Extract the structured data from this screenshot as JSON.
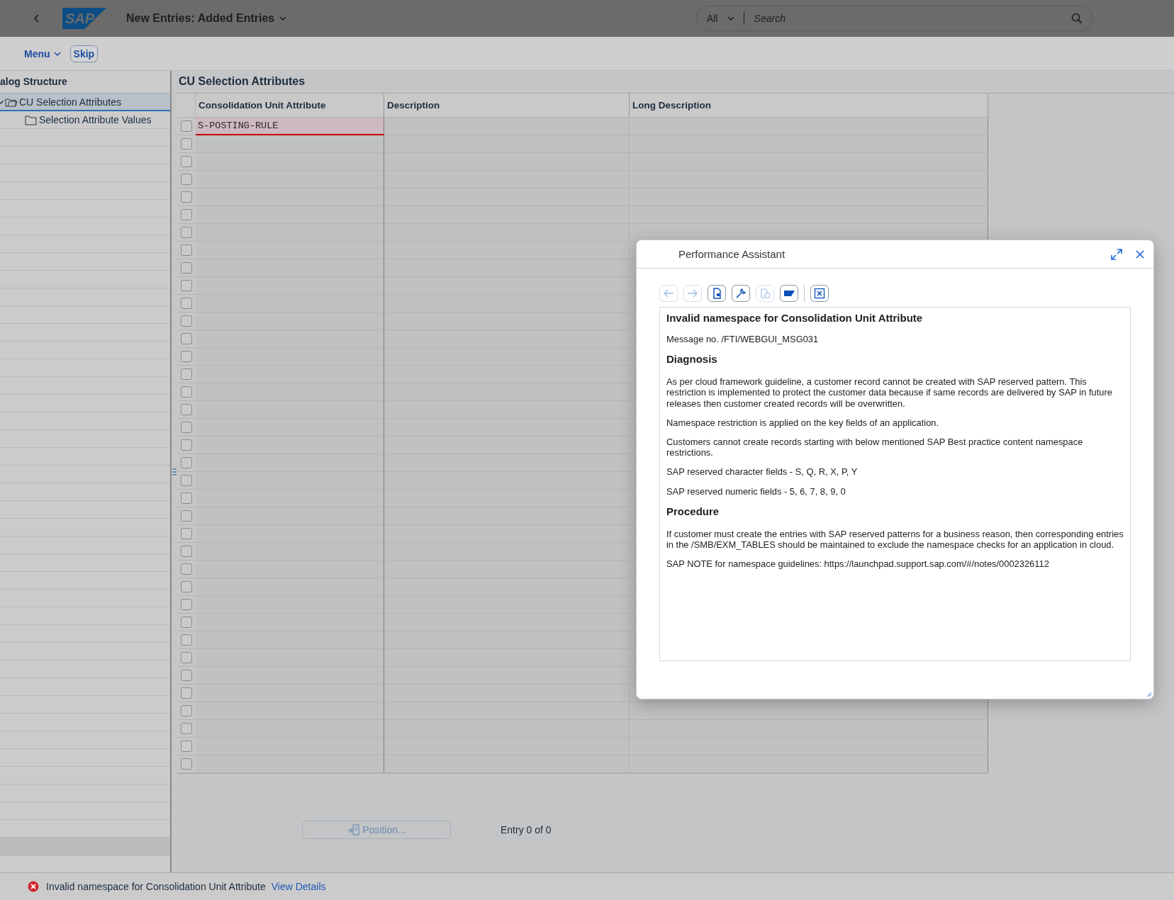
{
  "shell": {
    "logo_text": "SAP",
    "title": "New Entries: Added Entries",
    "search_scope": "All",
    "search_placeholder": "Search"
  },
  "toolbar": {
    "menu": "Menu",
    "skip": "Skip"
  },
  "dialog_structure": {
    "title": "alog Structure",
    "tree": [
      {
        "label": "CU Selection Attributes",
        "expanded": true,
        "selected": true,
        "children": [
          {
            "label": "Selection Attribute Values",
            "selected": false
          }
        ]
      }
    ]
  },
  "table": {
    "title": "CU Selection Attributes",
    "columns": [
      "Consolidation Unit Attribute",
      "Description",
      "Long Description"
    ],
    "rows": [
      {
        "selected": false,
        "error": true,
        "cells": [
          "S-POSTING-RULE"
        ]
      },
      {
        "selected": false
      },
      {
        "selected": false
      },
      {
        "selected": false
      },
      {
        "selected": false
      },
      {
        "selected": false
      },
      {
        "selected": false
      },
      {
        "selected": false
      },
      {
        "selected": false
      },
      {
        "selected": false
      },
      {
        "selected": false
      },
      {
        "selected": false
      },
      {
        "selected": false
      },
      {
        "selected": false
      },
      {
        "selected": false
      },
      {
        "selected": false
      },
      {
        "selected": false
      },
      {
        "selected": false
      },
      {
        "selected": false
      },
      {
        "selected": false
      },
      {
        "selected": false
      },
      {
        "selected": false
      },
      {
        "selected": false
      },
      {
        "selected": false
      },
      {
        "selected": false
      },
      {
        "selected": false
      },
      {
        "selected": false
      },
      {
        "selected": false
      },
      {
        "selected": false
      },
      {
        "selected": false
      },
      {
        "selected": false
      },
      {
        "selected": false
      },
      {
        "selected": false
      },
      {
        "selected": false
      },
      {
        "selected": false
      },
      {
        "selected": false
      },
      {
        "selected": false
      }
    ]
  },
  "footer": {
    "position_button": {
      "label": "Position...",
      "disabled": true
    },
    "entry_count": "Entry 0 of 0"
  },
  "dialog": {
    "title": "Performance Assistant",
    "toolbar": [
      {
        "kind": "back",
        "disabled": true
      },
      {
        "kind": "forward",
        "disabled": true
      },
      {
        "kind": "document",
        "disabled": false
      },
      {
        "kind": "wrench",
        "disabled": false
      },
      {
        "kind": "globe-document",
        "disabled": true
      },
      {
        "kind": "logo",
        "disabled": false
      },
      {
        "kind": "separator"
      },
      {
        "kind": "close-box",
        "disabled": false
      }
    ],
    "content": [
      {
        "kind": "title",
        "text": "Invalid namespace for Consolidation Unit Attribute"
      },
      {
        "kind": "text",
        "text": "Message no. /FTI/WEBGUI_MSG031"
      },
      {
        "kind": "heading",
        "text": "Diagnosis"
      },
      {
        "kind": "text",
        "text": "As per cloud framework guideline, a customer record cannot be created with SAP reserved pattern. This restriction is implemented to protect the customer data because if same records are delivered by SAP in future releases then customer created records will be overwritten."
      },
      {
        "kind": "text",
        "text": "Namespace restriction is applied on the key fields of an application."
      },
      {
        "kind": "text",
        "text": "Customers cannot create records starting with below mentioned SAP Best practice content namespace restrictions."
      },
      {
        "kind": "text",
        "text": "SAP reserved character fields - S, Q, R, X, P, Y"
      },
      {
        "kind": "text",
        "text": "SAP reserved numeric fields - 5, 6, 7, 8, 9, 0"
      },
      {
        "kind": "heading",
        "text": "Procedure"
      },
      {
        "kind": "text",
        "text": "If customer must create the entries with SAP reserved patterns for a business reason, then corresponding entries in the /SMB/EXM_TABLES should be maintained to exclude the namespace checks for an application in cloud."
      },
      {
        "kind": "text",
        "text": "SAP NOTE for namespace guidelines: https://launchpad.support.sap.com/#/notes/0002326112"
      }
    ]
  },
  "status_bar": {
    "message": "Invalid namespace for Consolidation Unit Attribute",
    "link": "View Details"
  }
}
